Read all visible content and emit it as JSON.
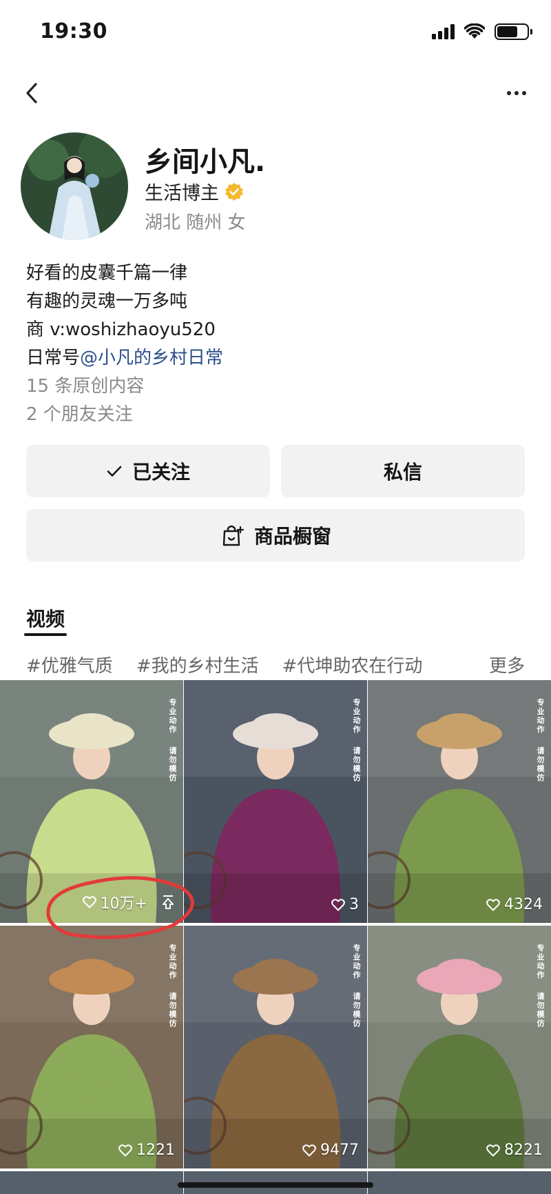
{
  "status_bar": {
    "time": "19:30"
  },
  "profile": {
    "name": "乡间小凡.",
    "blogger_label": "生活博主",
    "location": "湖北 随州 女"
  },
  "bio": {
    "line1": "好看的皮囊千篇一律",
    "line2": "有趣的灵魂一万多吨",
    "line3": "商 v:woshizhaoyu520",
    "line4_prefix": "日常号",
    "line4_link": "@小凡的乡村日常",
    "original_count": "15 条原创内容",
    "friends_follow": "2 个朋友关注"
  },
  "buttons": {
    "follow": "已关注",
    "message": "私信",
    "shop": "商品橱窗"
  },
  "tabs": {
    "video": "视频"
  },
  "tags": [
    "#优雅气质",
    "#我的乡村生活",
    "#代坤助农在行动"
  ],
  "tags_more": "更多",
  "watermark": {
    "top": "专业动作",
    "bottom": "请勿模仿"
  },
  "videos": [
    {
      "likes": "10万+",
      "dress": "#c9dc8e",
      "hat": "#e9e4c8",
      "bg": "#6f7a73",
      "pinned": true
    },
    {
      "likes": "3",
      "dress": "#7a2a5e",
      "hat": "#e6ddd6",
      "bg": "#4a5461"
    },
    {
      "likes": "4324",
      "dress": "#7c9a4d",
      "hat": "#c8a06a",
      "bg": "#6a6e6e"
    },
    {
      "likes": "1221",
      "dress": "#8cab5a",
      "hat": "#c28a55",
      "bg": "#7b6a57"
    },
    {
      "likes": "9477",
      "dress": "#8a6840",
      "hat": "#9b7550",
      "bg": "#59606b"
    },
    {
      "likes": "8221",
      "dress": "#5e7a3e",
      "hat": "#e9a7b8",
      "bg": "#7e8578"
    }
  ]
}
